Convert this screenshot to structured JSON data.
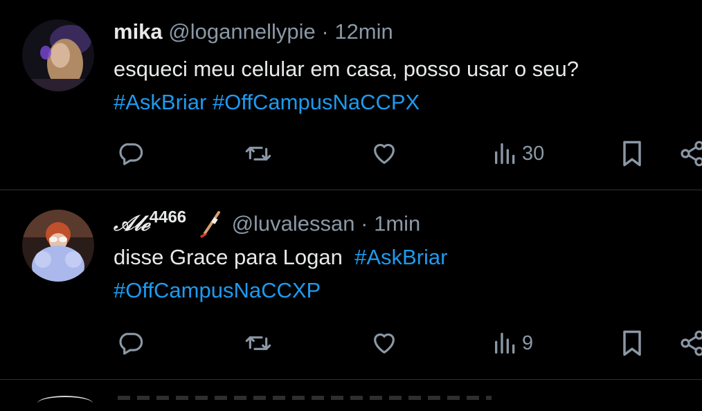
{
  "tweets": [
    {
      "name": "mika",
      "handle": "@logannellypie",
      "sep": "·",
      "time": "12min",
      "text_line1": "esqueci meu celular em casa, posso usar o seu?",
      "hashtag1": "#AskBriar",
      "hashtag2": "#OffCampusNaCCPX",
      "views": "30",
      "avatar_icon": "user-photo-avatar"
    },
    {
      "name": "𝒜𝓁ℯ",
      "name_sup": "4466",
      "handle": "@luvalessan",
      "sep": "·",
      "time": "1min",
      "text_line1": "disse Grace para Logan",
      "hashtag1": "#AskBriar",
      "hashtag2": "#OffCampusNaCCXP",
      "views": "9",
      "avatar_icon": "user-photo-avatar"
    }
  ],
  "icons": {
    "reply": "reply-icon",
    "retweet": "retweet-icon",
    "like": "heart-icon",
    "views": "views-bar-chart-icon",
    "bookmark": "bookmark-icon",
    "share": "share-icon",
    "emoji": "hockey-stick-icon"
  },
  "colors": {
    "background": "#000000",
    "text": "#e7e9ea",
    "muted": "#8b98a5",
    "hashtag": "#1d9bf0",
    "divider": "#2f3336"
  }
}
